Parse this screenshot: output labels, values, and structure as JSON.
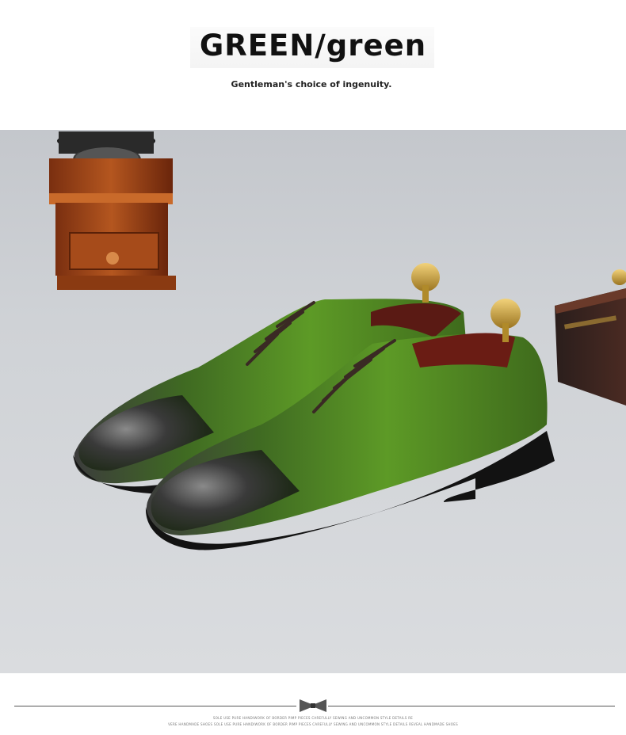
{
  "header": {
    "title": "GREEN/green",
    "subtitle": "Gentleman's choice of ingenuity."
  },
  "product_photo": {
    "subject": "green-cap-toe-oxford-shoes",
    "accent_color": "#4f8a22",
    "background_color": "#cfd2d6"
  },
  "footer": {
    "icon": "bow-tie-icon",
    "fine_print_line1": "SOLE USE PURE HANDIWORK OF BORDER PIMP PIECES CAREFULLY SEWING AND UNCOMMON STYLE DETAILS RE",
    "fine_print_line2": "VERE HANDMADE SHOES SOLE USE PURE HANDIWORK OF BORDER PIMP PIECES CAREFULLY SEWING AND UNCOMMON STYLE DETAILS REVEAL HANDMADE SHOES"
  }
}
